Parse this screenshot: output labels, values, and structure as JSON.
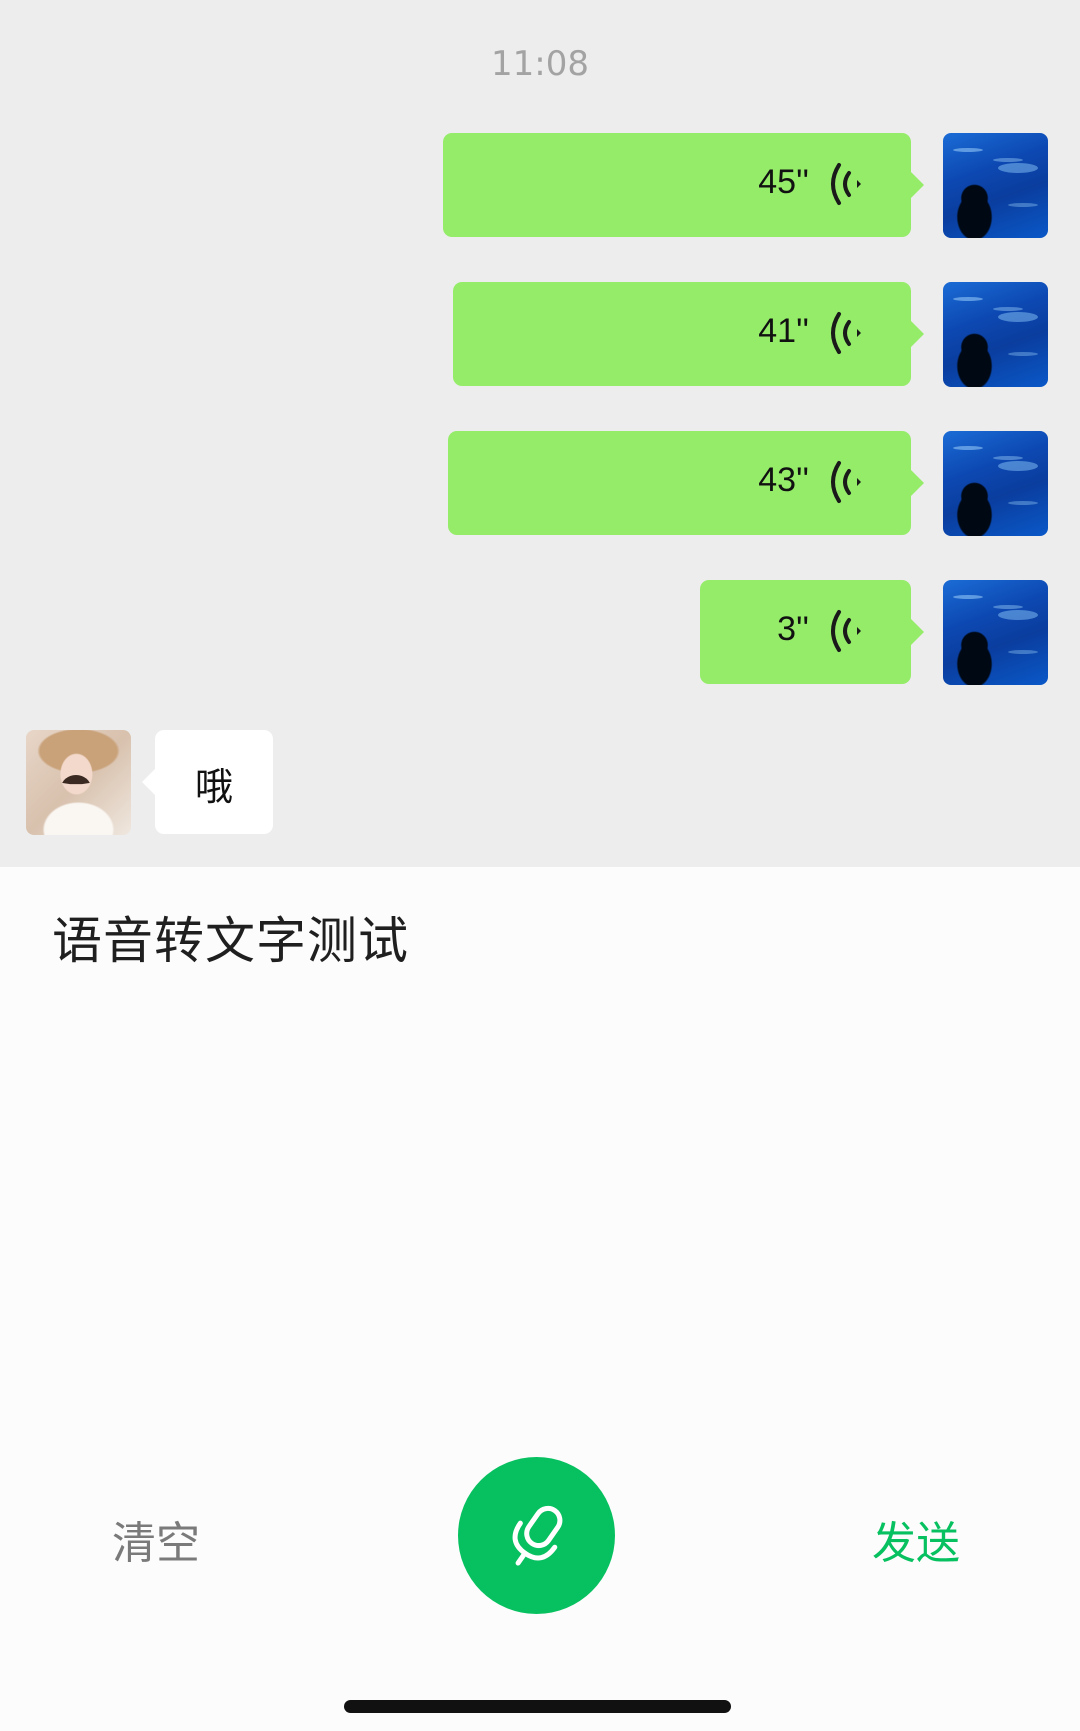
{
  "chat": {
    "timestamp": "11:08",
    "voice_messages": [
      {
        "duration": "45''"
      },
      {
        "duration": "41''"
      },
      {
        "duration": "43''"
      },
      {
        "duration": "3''"
      }
    ],
    "reply_text": "哦"
  },
  "panel": {
    "transcript": "语音转文字测试",
    "clear_label": "清空",
    "send_label": "发送",
    "mic_icon": "microphone-icon"
  },
  "colors": {
    "chat_background": "#ededed",
    "self_bubble": "#95ec69",
    "accent_green": "#07c160",
    "panel_background": "#fcfcfc"
  }
}
